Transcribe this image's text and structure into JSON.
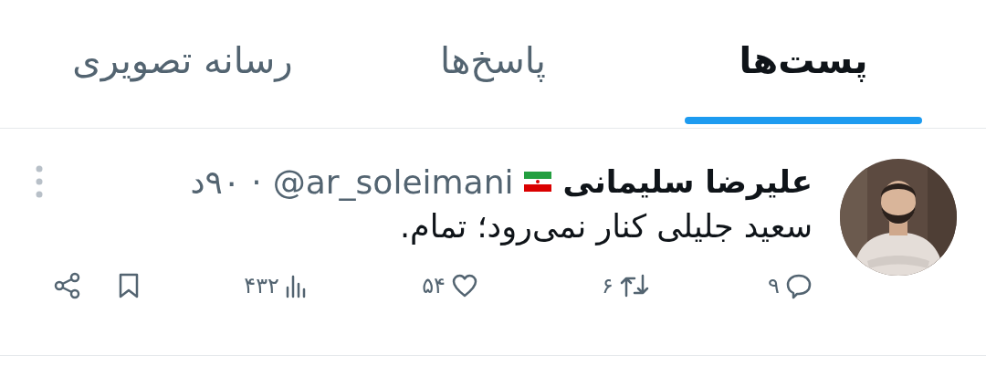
{
  "tabs": [
    {
      "label": "پست‌ها",
      "selected": true
    },
    {
      "label": "پاسخ‌ها",
      "selected": false
    },
    {
      "label": "رسانه تصویری",
      "selected": false
    }
  ],
  "post": {
    "author": "علیرضا سلیمانی",
    "handle": "@ar_soleimani",
    "separator": "·",
    "time": "۹۰د",
    "text": "سعید جلیلی کنار نمی‌رود؛ تمام.",
    "actions": [
      {
        "kind": "reply",
        "count": "۹"
      },
      {
        "kind": "repost",
        "count": "۶"
      },
      {
        "kind": "like",
        "count": "۵۴"
      },
      {
        "kind": "views",
        "count": "۴۳۲"
      },
      {
        "kind": "bookmark"
      },
      {
        "kind": "share"
      }
    ]
  }
}
